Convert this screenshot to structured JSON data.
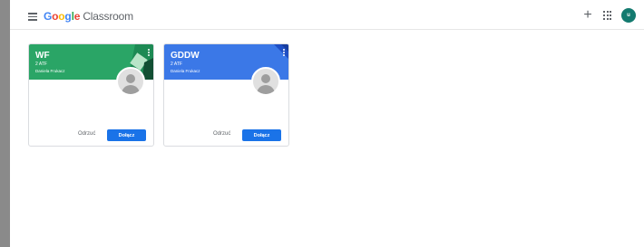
{
  "header": {
    "brand_google": "Google",
    "brand_product": "Classroom",
    "plus_symbol": "+",
    "avatar_initial": "u"
  },
  "classes": [
    {
      "title": "WF",
      "section": "2 ATF",
      "owner": "Daniela Frukacz",
      "header_color": "#2aa566",
      "decline_label": "Odrzuć",
      "join_label": "Dołącz"
    },
    {
      "title": "GDDW",
      "section": "2 ATF",
      "owner": "Daniela Frukacz",
      "header_color": "#3b78e7",
      "decline_label": "Odrzuć",
      "join_label": "Dołącz"
    }
  ],
  "colors": {
    "google_blue": "#4285f4",
    "google_red": "#ea4335",
    "google_yellow": "#fbbc05",
    "google_green": "#34a853",
    "primary_button": "#1a73e8",
    "avatar": "#137a6f"
  }
}
